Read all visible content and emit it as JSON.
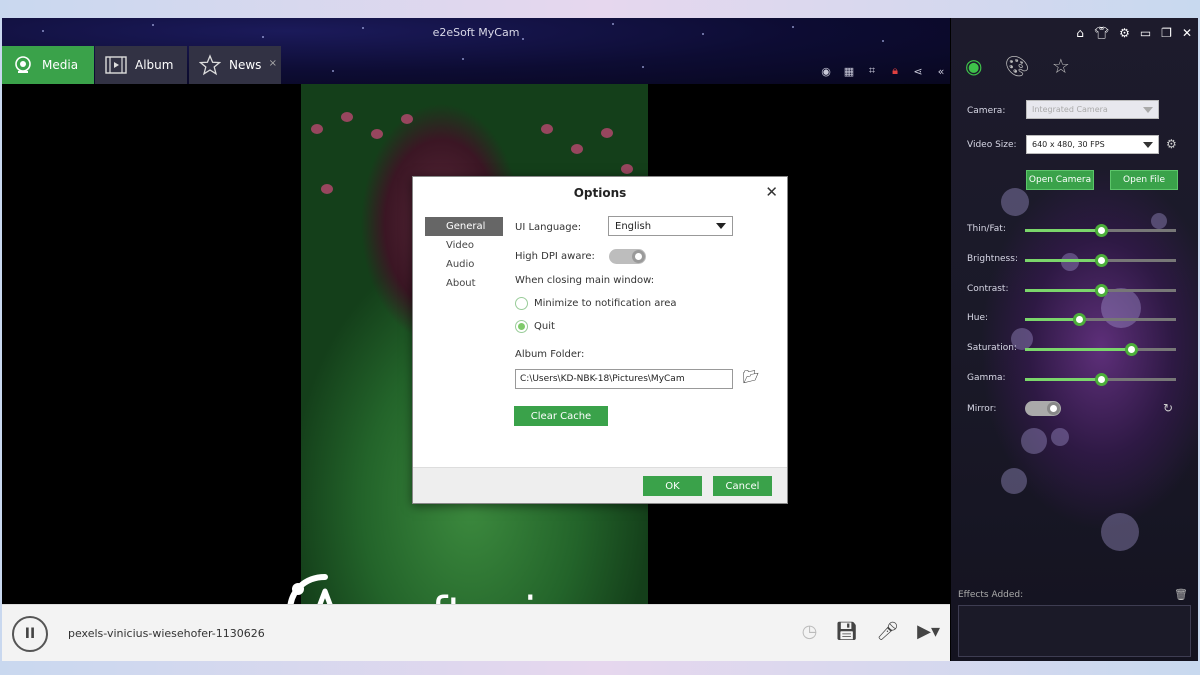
{
  "app": {
    "title": "e2eSoft MyCam"
  },
  "tabs": [
    {
      "label": "Media",
      "icon": "webcam-icon",
      "active": true
    },
    {
      "label": "Album",
      "icon": "film-icon",
      "active": false
    },
    {
      "label": "News",
      "icon": "star-icon",
      "active": false,
      "close": "×"
    }
  ],
  "toolbar": {
    "icons": [
      "broadcast-icon",
      "qr-icon",
      "crop-icon",
      "lock-icon",
      "share-icon",
      "collapse-icon"
    ]
  },
  "bottom": {
    "pause_label": "II",
    "filename": "pexels-vinicius-wiesehofer-1130626",
    "icons": [
      "clock-icon",
      "save-icon",
      "microphone-icon",
      "camera-icon"
    ]
  },
  "watermark": {
    "text": "softonic.com"
  },
  "panel": {
    "window_controls": [
      "home-icon",
      "shirt-icon",
      "gear-icon",
      "restore-icon",
      "close-icon"
    ],
    "tabs": [
      "webcam-icon",
      "palette-icon",
      "star-icon"
    ],
    "camera_label": "Camera:",
    "camera_value": "Integrated Camera",
    "video_size_label": "Video Size:",
    "video_size_value": "640 x 480, 30 FPS",
    "open_camera": "Open Camera",
    "open_file": "Open File",
    "sliders": [
      {
        "label": "Thin/Fat:",
        "value": 0.5
      },
      {
        "label": "Brightness:",
        "value": 0.5
      },
      {
        "label": "Contrast:",
        "value": 0.5
      },
      {
        "label": "Hue:",
        "value": 0.36
      },
      {
        "label": "Saturation:",
        "value": 0.7
      },
      {
        "label": "Gamma:",
        "value": 0.5
      }
    ],
    "mirror_label": "Mirror:",
    "effects_label": "Effects Added:"
  },
  "dialog": {
    "title": "Options",
    "close": "✕",
    "nav": [
      "General",
      "Video",
      "Audio",
      "About"
    ],
    "ui_language_label": "UI Language:",
    "ui_language_value": "English",
    "high_dpi_label": "High DPI aware:",
    "closing_label": "When closing main window:",
    "option_minimize": "Minimize to notification area",
    "option_quit": "Quit",
    "album_folder_label": "Album Folder:",
    "album_folder_value": "C:\\Users\\KD-NBK-18\\Pictures\\MyCam",
    "clear_cache": "Clear Cache",
    "ok": "OK",
    "cancel": "Cancel"
  }
}
